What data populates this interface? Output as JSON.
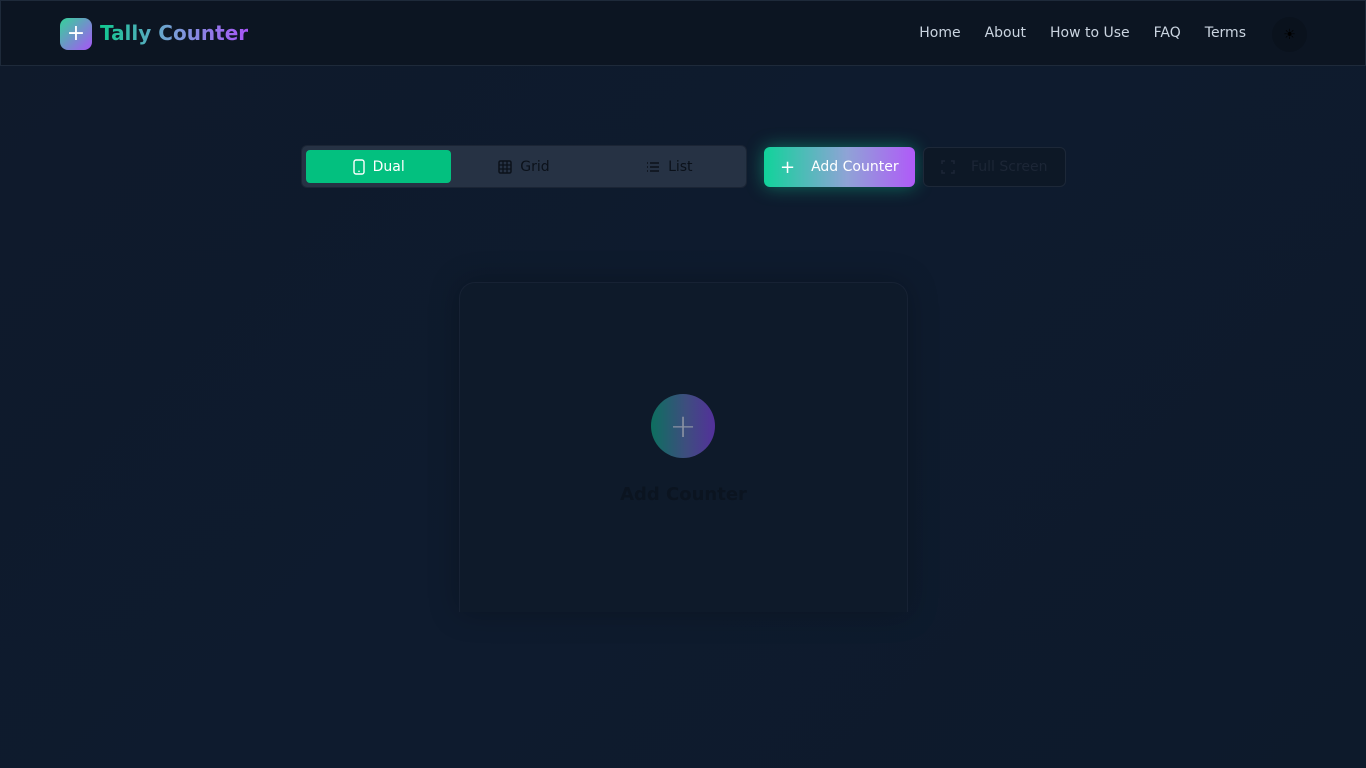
{
  "header": {
    "brand": "Tally Counter",
    "nav": [
      "Home",
      "About",
      "How to Use",
      "FAQ",
      "Terms"
    ]
  },
  "toolbar": {
    "modes": [
      "Dual",
      "Grid",
      "List"
    ],
    "active_mode": "Dual",
    "add_label": "Add Counter",
    "fullscreen_label": "Full Screen"
  },
  "card": {
    "label": "Add Counter"
  },
  "colors": {
    "accent": "#03c07f",
    "purple": "#a855f7",
    "background": "#0f1a2b"
  }
}
